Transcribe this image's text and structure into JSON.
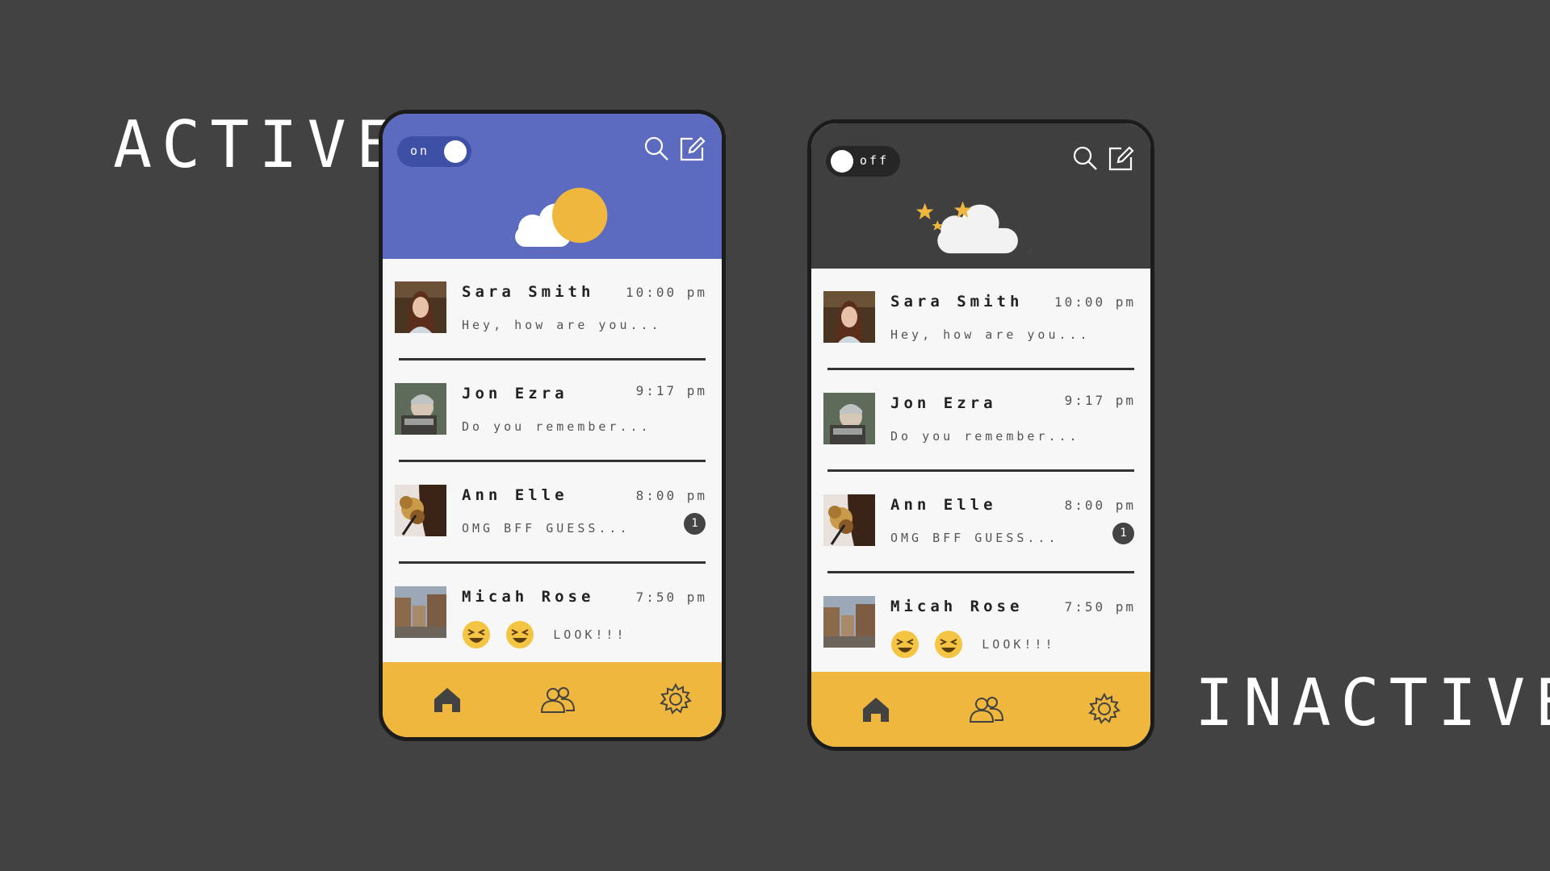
{
  "labels": {
    "active": "ACTIVE",
    "inactive": "INACTIVE"
  },
  "colors": {
    "background": "#424242",
    "active_header": "#5c6bc0",
    "inactive_header": "#3f3f3f",
    "accent_yellow": "#efb73e",
    "list_background": "#f7f7f7"
  },
  "phones": [
    {
      "mode": "active",
      "toggle_text": "on",
      "weather_icon": "cloud-sun-icon",
      "icons": [
        "search-icon",
        "compose-icon"
      ],
      "conversations": [
        {
          "name": "Sara Smith",
          "time": "10:00 pm",
          "preview": "Hey, how are you..."
        },
        {
          "name": "Jon Ezra",
          "time": "9:17 pm",
          "preview": "Do you remember..."
        },
        {
          "name": "Ann Elle",
          "time": "8:00 pm",
          "preview": "OMG BFF GUESS...",
          "badge": "1"
        },
        {
          "name": "Micah Rose",
          "time": "7:50 pm",
          "preview": "LOOK!!!"
        }
      ],
      "nav": [
        "home-icon",
        "friends-icon",
        "settings-icon"
      ]
    },
    {
      "mode": "inactive",
      "toggle_text": "off",
      "weather_icon": "cloud-moon-stars-icon",
      "icons": [
        "search-icon",
        "compose-icon"
      ],
      "conversations": [
        {
          "name": "Sara Smith",
          "time": "10:00 pm",
          "preview": "Hey, how are you..."
        },
        {
          "name": "Jon Ezra",
          "time": "9:17 pm",
          "preview": "Do you remember..."
        },
        {
          "name": "Ann Elle",
          "time": "8:00 pm",
          "preview": "OMG BFF GUESS...",
          "badge": "1"
        },
        {
          "name": "Micah Rose",
          "time": "7:50 pm",
          "preview": "LOOK!!!"
        }
      ],
      "nav": [
        "home-icon",
        "friends-icon",
        "settings-icon"
      ]
    }
  ]
}
